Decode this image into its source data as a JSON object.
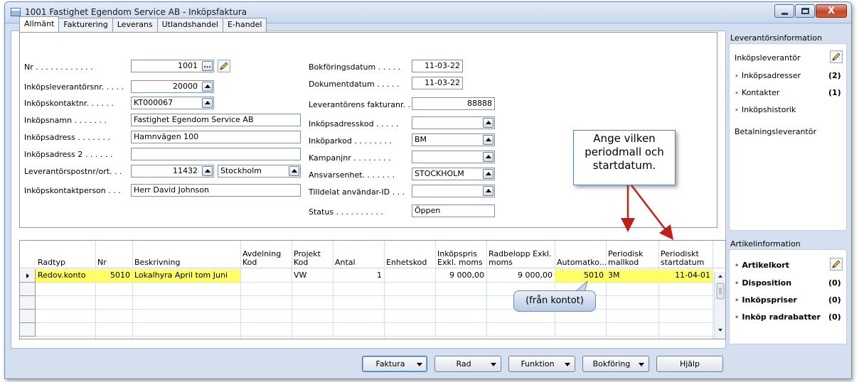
{
  "window": {
    "title": "1001 Fastighet Egendom Service AB - Inköpsfaktura",
    "close_glyph": "X"
  },
  "tabs": [
    "Allmänt",
    "Fakturering",
    "Leverans",
    "Utlandshandel",
    "E-handel"
  ],
  "general": {
    "nr_label": "Nr . . . . . . . . . . . .",
    "nr_value": "1001",
    "vendor_no_label": "Inköpsleverantörsnr. . . . .",
    "vendor_no_value": "20000",
    "contact_no_label": "Inköpskontaktnr. . . . . .",
    "contact_no_value": "KT000067",
    "name_label": "Inköpsnamn . . . . . . .",
    "name_value": "Fastighet Egendom Service AB",
    "address_label": "Inköpsadress . . . . . . .",
    "address_value": "Hamnvägen 100",
    "address2_label": "Inköpsadress 2 . . . . . .",
    "address2_value": "",
    "postcode_label": "Leverantörspostnr/ort. . .",
    "postcode_value": "11432",
    "city_value": "Stockholm",
    "contact_person_label": "Inköpskontaktperson . . .",
    "contact_person_value": "Herr David Johnson",
    "posting_date_label": "Bokföringsdatum . . . . .",
    "posting_date_value": "11-03-22",
    "document_date_label": "Dokumentdatum . . . . .",
    "document_date_value": "11-03-22",
    "vendor_invoice_label": "Leverantörens fakturanr. .",
    "vendor_invoice_value": "88888",
    "order_address_label": "Inköpsadresskod . . . . .",
    "order_address_value": "",
    "purchaser_label": "Inköparkod . . . . . . . .",
    "purchaser_value": "BM",
    "campaign_label": "Kampanjnr . . . . . . . .",
    "campaign_value": "",
    "responsibility_label": "Ansvarsenhet. . . . . . .",
    "responsibility_value": "STOCKHOLM",
    "assigned_user_label": "Tilldelat användar-ID . . .",
    "assigned_user_value": "",
    "status_label": "Status . . . . . . . . . .",
    "status_value": "Öppen"
  },
  "lines": {
    "headers": [
      "Radtyp",
      "Nr",
      "Beskrivning",
      "Avdelning\nKod",
      "Projekt\nKod",
      "Antal",
      "Enhetskod",
      "Inköpspris\nExkl. moms",
      "Radbelopp Exkl.\nmoms",
      "Automatko...",
      "Periodisk\nmallkod",
      "Periodiskt\nstartdatum"
    ],
    "rows": [
      {
        "type": "Redov.konto",
        "no": "5010",
        "desc": "Lokalhyra April tom Juni",
        "dept": "",
        "project": "VW",
        "qty": "1",
        "unit": "",
        "price": "9 000,00",
        "amount": "9 000,00",
        "auto": "5010",
        "template": "3M",
        "start": "11-04-01"
      }
    ]
  },
  "sidebar": {
    "vendor_info_title": "Leverantörsinformation",
    "vendor_label": "Inköpsleverantör",
    "order_addresses": "Inköpsadresser",
    "order_addresses_count": "(2)",
    "contacts": "Kontakter",
    "contacts_count": "(1)",
    "history": "Inköpshistorik",
    "pay_to_vendor": "Betalningsleverantör",
    "item_info_title": "Artikelinformation",
    "item_card": "Artikelkort",
    "availability": "Disposition",
    "availability_count": "(0)",
    "prices": "Inköpspriser",
    "prices_count": "(0)",
    "line_discounts": "Inköp radrabatter",
    "line_discounts_count": "(0)"
  },
  "buttons": {
    "invoice": "Faktura",
    "line": "Rad",
    "function": "Funktion",
    "posting": "Bokföring",
    "help": "Hjälp"
  },
  "annotations": {
    "callout": "Ange vilken periodmall och startdatum.",
    "bubble": "(från kontot)"
  },
  "colors": {
    "highlight": "#ffff66",
    "arrow": "#c0201a"
  }
}
